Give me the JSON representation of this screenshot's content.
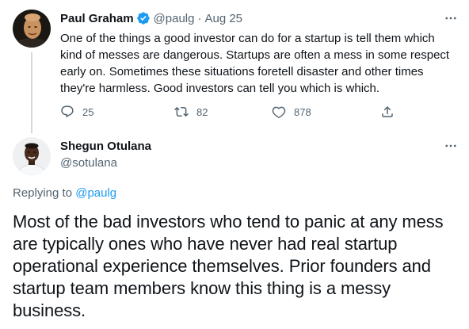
{
  "parent_tweet": {
    "author_name": "Paul Graham",
    "handle": "@paulg",
    "separator": "·",
    "date": "Aug 25",
    "verified": true,
    "text": "One of the things a good investor can do for a startup is tell them which kind of messes are dangerous. Startups are often a mess in some respect early on. Sometimes these situations foretell disaster and other times they're harmless. Good investors can tell you which is which.",
    "actions": {
      "reply_count": "25",
      "retweet_count": "82",
      "like_count": "878"
    }
  },
  "reply_tweet": {
    "author_name": "Shegun Otulana",
    "handle": "@sotulana",
    "replying_to_label": "Replying to ",
    "replying_to_handle": "@paulg",
    "text": "Most of the bad investors who tend to panic at any mess are typically ones who have never had real startup operational experience themselves. Prior founders and startup team members know this thing is a messy business."
  },
  "colors": {
    "text_primary": "#0f1419",
    "text_secondary": "#536471",
    "link": "#1d9bf0",
    "verified_badge": "#1d9bf0",
    "thread_line": "#cfd9de"
  },
  "icons": [
    "verified-badge-icon",
    "more-options-icon",
    "reply-icon",
    "retweet-icon",
    "like-icon",
    "share-icon"
  ]
}
